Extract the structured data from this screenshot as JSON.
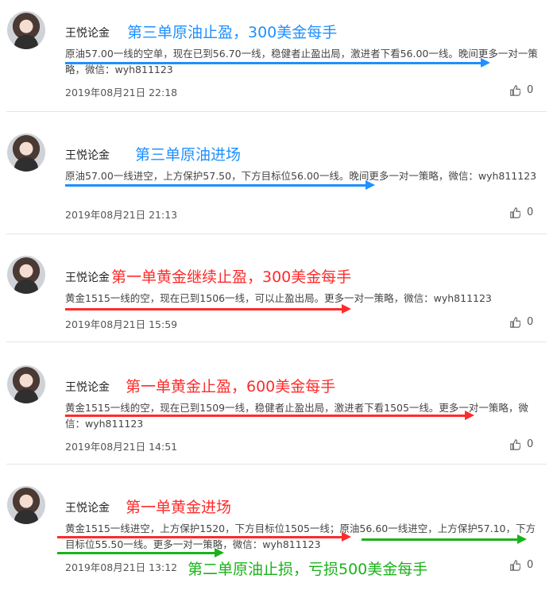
{
  "colors": {
    "blue": "#1e90ff",
    "red": "#ff2b2b",
    "green": "#1ab31a"
  },
  "posts": [
    {
      "author": "王悦论金",
      "headline": "第三单原油止盈，300美金每手",
      "headline_color": "blue",
      "content": "原油57.00一线的空单，现在已到56.70一线，稳健者止盈出局，激进者下看56.00一线。晚间更多一对一策略，微信：wyh811123",
      "time": "2019年08月21日 22:18",
      "likes": "0"
    },
    {
      "author": "王悦论金",
      "headline": "第三单原油进场",
      "headline_color": "blue",
      "content": "原油57.00一线进空，上方保护57.50，下方目标位56.00一线。晚间更多一对一策略，微信：wyh811123",
      "time": "2019年08月21日 21:13",
      "likes": "0"
    },
    {
      "author": "王悦论金",
      "headline": "第一单黄金继续止盈，300美金每手",
      "headline_color": "red",
      "content": "黄金1515一线的空，现在已到1506一线，可以止盈出局。更多一对一策略，微信：wyh811123",
      "time": "2019年08月21日 15:59",
      "likes": "0"
    },
    {
      "author": "王悦论金",
      "headline": "第一单黄金止盈，600美金每手",
      "headline_color": "red",
      "content": "黄金1515一线的空，现在已到1509一线，稳健者止盈出局，激进者下看1505一线。更多一对一策略，微信：wyh811123",
      "time": "2019年08月21日 14:51",
      "likes": "0"
    },
    {
      "author": "王悦论金",
      "headline": "第一单黄金进场",
      "headline_color": "red",
      "content": "黄金1515一线进空，上方保护1520，下方目标位1505一线；原油56.60一线进空，上方保护57.10，下方目标位55.50一线。更多一对一策略，微信：wyh811123",
      "time": "2019年08月21日 13:12",
      "likes": "0",
      "extra_headline": "第二单原油止损，亏损500美金每手",
      "extra_headline_color": "green"
    }
  ]
}
